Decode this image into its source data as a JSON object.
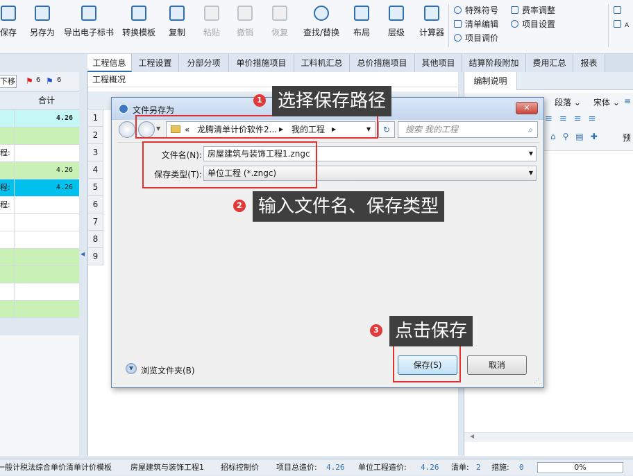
{
  "ribbon": {
    "buttons": [
      {
        "label": "保存",
        "icon": "save-icon"
      },
      {
        "label": "另存为",
        "icon": "save-as-icon"
      },
      {
        "label": "导出电子标书",
        "icon": "export-icon"
      },
      {
        "label": "转换模板",
        "icon": "convert-icon"
      },
      {
        "label": "复制",
        "icon": "copy-icon"
      },
      {
        "label": "粘贴",
        "icon": "paste-icon"
      },
      {
        "label": "撤销",
        "icon": "undo-icon"
      },
      {
        "label": "恢复",
        "icon": "redo-icon"
      },
      {
        "label": "查找/替换",
        "icon": "search-icon"
      },
      {
        "label": "布局",
        "icon": "layout-icon"
      },
      {
        "label": "层级",
        "icon": "hierarchy-icon"
      },
      {
        "label": "计算器",
        "icon": "calculator-icon"
      }
    ],
    "small": [
      "特殊符号",
      "清单编辑",
      "项目调价",
      "费率调整",
      "项目设置"
    ],
    "edge_label": "A"
  },
  "left": {
    "move_label": "下移",
    "flag_red_count": "6",
    "flag_blue_count": "6",
    "header_total": "合计",
    "rows": [
      {
        "c1": "",
        "c2": "4.26",
        "color": "#c6f7f7"
      },
      {
        "c1": "",
        "c2": "",
        "color": "#c9f0b5"
      },
      {
        "c1": "程:",
        "c2": "",
        "color": "#ffffff"
      },
      {
        "c1": "",
        "c2": "4.26",
        "color": "#c9f0b5"
      },
      {
        "c1": "程:",
        "c2": "4.26",
        "color": "#00c0ee"
      },
      {
        "c1": "程:",
        "c2": "",
        "color": "#ffffff"
      },
      {
        "c1": "",
        "c2": "",
        "color": "#ffffff"
      },
      {
        "c1": "",
        "c2": "",
        "color": "#ffffff"
      },
      {
        "c1": "",
        "c2": "",
        "color": "#c9f0b5"
      },
      {
        "c1": "",
        "c2": "",
        "color": "#c9f0b5"
      },
      {
        "c1": "",
        "c2": "",
        "color": "#ffffff"
      },
      {
        "c1": "",
        "c2": "",
        "color": "#c9f0b5"
      }
    ]
  },
  "tabs": [
    "工程信息",
    "工程设置",
    "分部分项",
    "单价措施项目",
    "工料机汇总",
    "总价措施项目",
    "其他项目",
    "结算阶段附加",
    "费用汇总",
    "报表"
  ],
  "center": {
    "section_label": "工程概况",
    "row_numbers": [
      "1",
      "2",
      "3",
      "4",
      "5",
      "6",
      "7",
      "8",
      "9"
    ]
  },
  "right": {
    "title": "编制说明",
    "toolbar": {
      "paragraph": "段落",
      "font": "宋体",
      "preview": "预"
    }
  },
  "dialog": {
    "title": "文件另存为",
    "path_prefix": "«",
    "path_parts": [
      "龙腾清单计价软件2...",
      "我的工程"
    ],
    "search_placeholder": "搜索 我的工程",
    "filename_label": "文件名(N):",
    "filename_value": "房屋建筑与装饰工程1.zngc",
    "filetype_label": "保存类型(T):",
    "filetype_value": "单位工程 (*.zngc)",
    "browse_label": "浏览文件夹(B)",
    "save_label": "保存(S)",
    "cancel_label": "取消"
  },
  "annotations": [
    {
      "num": "1",
      "text": "选择保存路径"
    },
    {
      "num": "2",
      "text": "输入文件名、保存类型"
    },
    {
      "num": "3",
      "text": "点击保存"
    }
  ],
  "status": {
    "template": "一般计税法综合单价清单计价模板",
    "project": "房屋建筑与装饰工程1",
    "control_price": "招标控制价",
    "total_label": "项目总造价:",
    "total_value": "4.26",
    "unit_label": "单位工程造价:",
    "unit_value": "4.26",
    "list_label": "清单:",
    "list_value": "2",
    "measure_label": "措施:",
    "measure_value": "0",
    "progress_text": "0%",
    "progress": 0
  },
  "colors": {
    "accent": "#2f6fb1",
    "annotation_red": "#e03030",
    "callout_bg": "#3f3f3f"
  }
}
